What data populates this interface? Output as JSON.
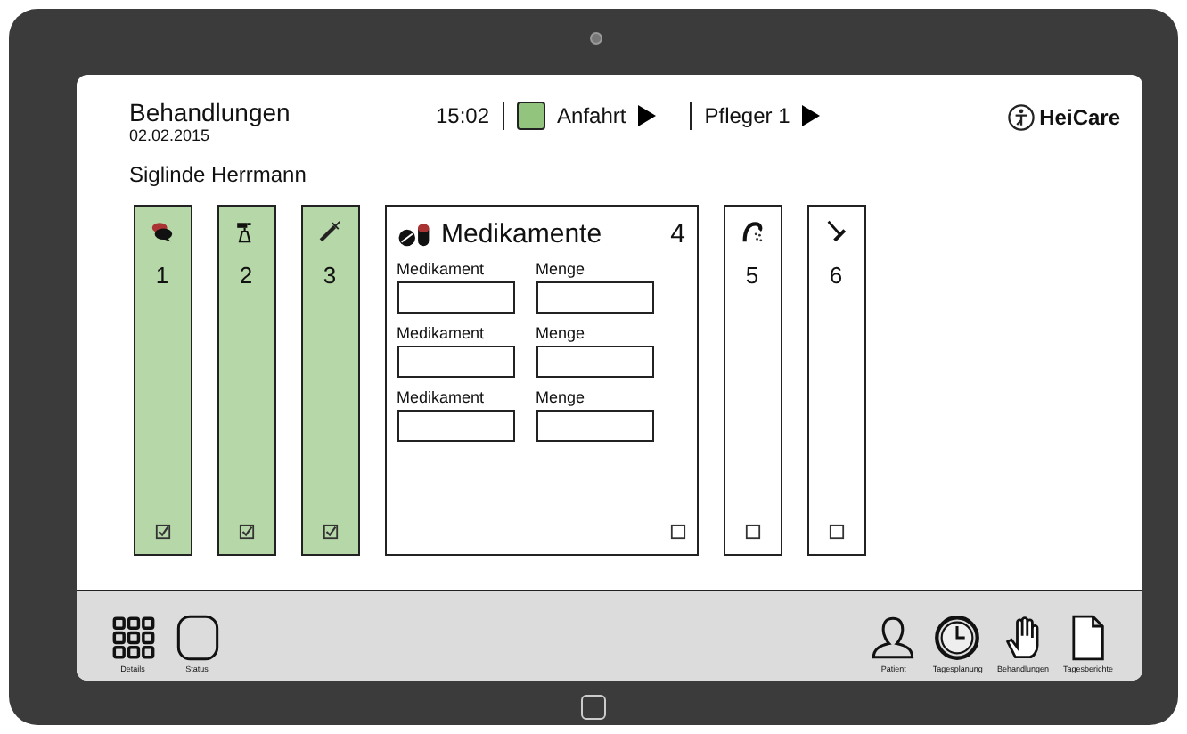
{
  "header": {
    "title": "Behandlungen",
    "date": "02.02.2015",
    "time": "15:02",
    "status": "Anfahrt",
    "caregiver": "Pfleger 1",
    "logo": "HeiCare"
  },
  "patient": "Siglinde Herrmann",
  "cards": [
    {
      "kind": "narrow",
      "number": "1",
      "checked": true
    },
    {
      "kind": "narrow",
      "number": "2",
      "checked": true
    },
    {
      "kind": "narrow",
      "number": "3",
      "checked": true
    },
    {
      "kind": "wide",
      "title": "Medikamente",
      "number": "4",
      "checked": false,
      "fields": [
        {
          "label_1": "Medikament",
          "label_2": "Menge"
        },
        {
          "label_1": "Medikament",
          "label_2": "Menge"
        },
        {
          "label_1": "Medikament",
          "label_2": "Menge"
        }
      ]
    },
    {
      "kind": "narrow",
      "number": "5",
      "checked": false
    },
    {
      "kind": "narrow",
      "number": "6",
      "checked": false
    }
  ],
  "nav_left": [
    {
      "label": "Details"
    },
    {
      "label": "Status"
    }
  ],
  "nav_right": [
    {
      "label": "Patient"
    },
    {
      "label": "Tagesplanung"
    },
    {
      "label": "Behandlungen"
    },
    {
      "label": "Tagesberichte"
    }
  ]
}
